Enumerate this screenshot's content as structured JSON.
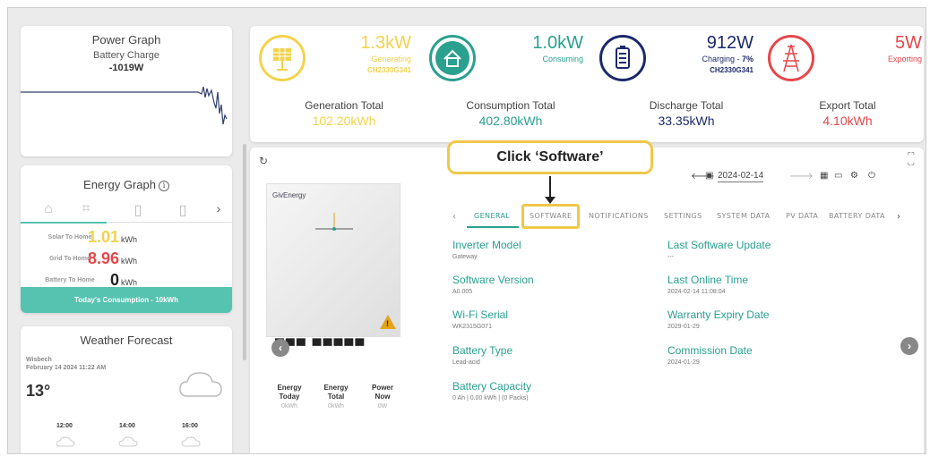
{
  "power_graph": {
    "title": "Power Graph",
    "subtitle": "Battery Charge",
    "value": "-1019W"
  },
  "energy_graph": {
    "title": "Energy Graph",
    "rows": [
      {
        "label": "Solar To Home",
        "value": "1.01",
        "unit": "kWh",
        "color": "#f3d34a"
      },
      {
        "label": "Grid To Home",
        "value": "8.96",
        "unit": "kWh",
        "color": "#e5474b"
      },
      {
        "label": "Battery To Home",
        "value": "0",
        "unit": "kWh",
        "color": "#222222"
      }
    ],
    "footer": "Today's Consumption - 10kWh",
    "next_glyph": "›"
  },
  "weather": {
    "title": "Weather Forecast",
    "location": "Wisbech",
    "datetime": "February 14 2024 11:22 AM",
    "temp": "13°",
    "hours": [
      "12:00",
      "14:00",
      "16:00"
    ]
  },
  "summary": {
    "solar": {
      "value": "1.3kW",
      "label": "Generating",
      "serial": "CH2330G341",
      "color": "#f3d34a"
    },
    "home": {
      "value": "1.0kW",
      "label": "Consuming",
      "color": "#2aa08f"
    },
    "battery": {
      "value": "912W",
      "label_prefix": "Charging - ",
      "label_pct": "7%",
      "serial": "CH2330G341",
      "color": "#1c2a6b"
    },
    "grid": {
      "value": "5W",
      "label": "Exporting",
      "color": "#e5474b"
    },
    "totals": [
      {
        "label": "Generation Total",
        "value": "102.20kWh",
        "color": "#f3d34a"
      },
      {
        "label": "Consumption Total",
        "value": "402.80kWh",
        "color": "#2aa08f"
      },
      {
        "label": "Discharge Total",
        "value": "33.35kWh",
        "color": "#1c2a6b"
      },
      {
        "label": "Export Total",
        "value": "4.10kWh",
        "color": "#e5474b"
      }
    ]
  },
  "main": {
    "brand": "GivEnergy",
    "date": "2024-02-14",
    "tabs": [
      "GENERAL",
      "SOFTWARE",
      "NOTIFICATIONS",
      "SETTINGS",
      "SYSTEM DATA",
      "PV DATA",
      "BATTERY DATA"
    ],
    "fields_left": [
      {
        "title": "Inverter Model",
        "value": "Gateway"
      },
      {
        "title": "Software Version",
        "value": "A0.005"
      },
      {
        "title": "Wi-Fi Serial",
        "value": "WK2315G071"
      },
      {
        "title": "Battery Type",
        "value": "Lead-acid"
      },
      {
        "title": "Battery Capacity",
        "value": "0 Ah | 0.00 kWh | (0 Packs)"
      }
    ],
    "fields_right": [
      {
        "title": "Last Software Update",
        "value": "---"
      },
      {
        "title": "Last Online Time",
        "value": "2024-02-14 11:08:04"
      },
      {
        "title": "Warranty Expiry Date",
        "value": "2029-01-29"
      },
      {
        "title": "Commission Date",
        "value": "2024-01-29"
      }
    ],
    "stats": [
      {
        "label1": "Energy",
        "label2": "Today",
        "value": "0kWh"
      },
      {
        "label1": "Energy",
        "label2": "Total",
        "value": "0kWh"
      },
      {
        "label1": "Power",
        "label2": "Now",
        "value": "0W"
      }
    ]
  },
  "callout": {
    "text": "Click ‘Software’"
  }
}
